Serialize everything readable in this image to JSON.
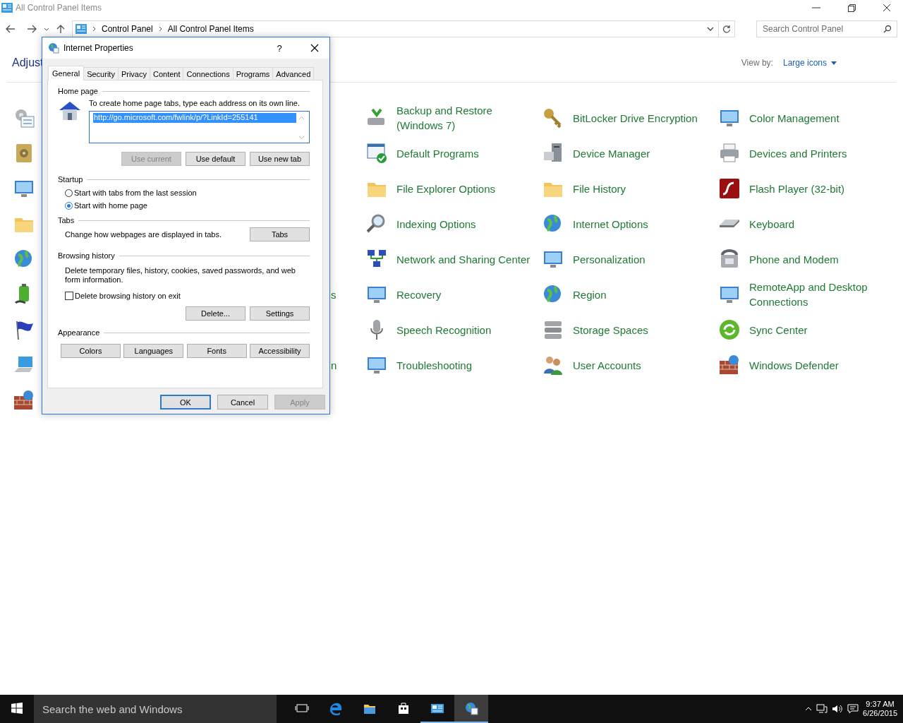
{
  "window": {
    "title": "All Control Panel Items"
  },
  "address_bar": {
    "breadcrumbs": [
      "Control Panel",
      "All Control Panel Items"
    ]
  },
  "search": {
    "placeholder": "Search Control Panel"
  },
  "heading": "Adjust",
  "view_by": {
    "label": "View by:",
    "value": "Large icons"
  },
  "columns": [
    {
      "items": [
        {
          "kind": "icon_only"
        },
        {
          "kind": "icon_only"
        },
        {
          "kind": "icon_only"
        },
        {
          "kind": "icon_only"
        },
        {
          "kind": "icon_only"
        },
        {
          "kind": "icon_only"
        },
        {
          "kind": "icon_only"
        },
        {
          "kind": "icon_only"
        },
        {
          "kind": "icon_only"
        }
      ]
    },
    {
      "items": [
        {
          "kind": "covered"
        },
        {
          "kind": "covered"
        },
        {
          "kind": "covered"
        },
        {
          "kind": "covered"
        },
        {
          "kind": "covered"
        },
        {
          "kind": "tail",
          "label": "s"
        },
        {
          "kind": "covered"
        },
        {
          "kind": "tail",
          "label": "n"
        }
      ]
    },
    {
      "items": [
        {
          "kind": "item",
          "label": "Backup and Restore (Windows 7)"
        },
        {
          "kind": "item",
          "label": "Default Programs"
        },
        {
          "kind": "item",
          "label": "File Explorer Options"
        },
        {
          "kind": "item",
          "label": "Indexing Options"
        },
        {
          "kind": "item",
          "label": "Network and Sharing Center"
        },
        {
          "kind": "item",
          "label": "Recovery"
        },
        {
          "kind": "item",
          "label": "Speech Recognition"
        },
        {
          "kind": "item",
          "label": "Troubleshooting"
        }
      ]
    },
    {
      "items": [
        {
          "kind": "item",
          "label": "BitLocker Drive Encryption"
        },
        {
          "kind": "item",
          "label": "Device Manager"
        },
        {
          "kind": "item",
          "label": "File History"
        },
        {
          "kind": "item",
          "label": "Internet Options"
        },
        {
          "kind": "item",
          "label": "Personalization"
        },
        {
          "kind": "item",
          "label": "Region"
        },
        {
          "kind": "item",
          "label": "Storage Spaces"
        },
        {
          "kind": "item",
          "label": "User Accounts"
        }
      ]
    },
    {
      "items": [
        {
          "kind": "item",
          "label": "Color Management"
        },
        {
          "kind": "item",
          "label": "Devices and Printers"
        },
        {
          "kind": "item",
          "label": "Flash Player (32-bit)"
        },
        {
          "kind": "item",
          "label": "Keyboard"
        },
        {
          "kind": "item",
          "label": "Phone and Modem"
        },
        {
          "kind": "item",
          "label": "RemoteApp and Desktop Connections"
        },
        {
          "kind": "item",
          "label": "Sync Center"
        },
        {
          "kind": "item",
          "label": "Windows Defender"
        }
      ]
    }
  ],
  "dialog": {
    "title": "Internet Properties",
    "help": "?",
    "tabs": [
      {
        "label": "General",
        "selected": true
      },
      {
        "label": "Security",
        "selected": false
      },
      {
        "label": "Privacy",
        "selected": false
      },
      {
        "label": "Content",
        "selected": false
      },
      {
        "label": "Connections",
        "selected": false
      },
      {
        "label": "Programs",
        "selected": false
      },
      {
        "label": "Advanced",
        "selected": false
      }
    ],
    "home_page": {
      "heading": "Home page",
      "instruction": "To create home page tabs, type each address on its own line.",
      "url": "http://go.microsoft.com/fwlink/p/?LinkId=255141",
      "url_selected": true,
      "buttons": [
        {
          "label": "Use current",
          "disabled": true
        },
        {
          "label": "Use default",
          "disabled": false
        },
        {
          "label": "Use new tab",
          "disabled": false
        }
      ]
    },
    "startup": {
      "heading": "Startup",
      "options": [
        {
          "label": "Start with tabs from the last session",
          "selected": false
        },
        {
          "label": "Start with home page",
          "selected": true
        }
      ]
    },
    "tabs_group": {
      "heading": "Tabs",
      "description": "Change how webpages are displayed in tabs.",
      "button": "Tabs"
    },
    "browsing_history": {
      "heading": "Browsing history",
      "description": "Delete temporary files, history, cookies, saved passwords, and web form information.",
      "checkbox": {
        "label": "Delete browsing history on exit",
        "checked": false
      },
      "buttons": [
        "Delete...",
        "Settings"
      ]
    },
    "appearance": {
      "heading": "Appearance",
      "buttons": [
        "Colors",
        "Languages",
        "Fonts",
        "Accessibility"
      ]
    },
    "footer_buttons": [
      {
        "label": "OK",
        "default": true,
        "disabled": false
      },
      {
        "label": "Cancel",
        "default": false,
        "disabled": false
      },
      {
        "label": "Apply",
        "default": false,
        "disabled": true
      }
    ]
  },
  "taskbar": {
    "search_placeholder": "Search the web and Windows",
    "apps": [
      {
        "open": false,
        "selected": false
      },
      {
        "open": false,
        "selected": false
      },
      {
        "open": false,
        "selected": false
      },
      {
        "open": false,
        "selected": false
      },
      {
        "open": true,
        "selected": false
      },
      {
        "open": true,
        "selected": true
      }
    ],
    "time": "9:37 AM",
    "date": "6/26/2015"
  }
}
